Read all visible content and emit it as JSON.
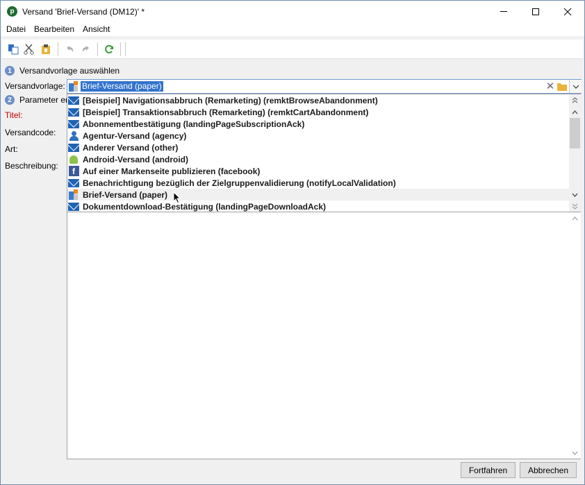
{
  "window": {
    "title": "Versand 'Brief-Versand (DM12)' *",
    "app_icon_glyph": "p"
  },
  "menu": {
    "items": [
      "Datei",
      "Bearbeiten",
      "Ansicht"
    ]
  },
  "toolbar": {
    "icons": [
      "paste-icon",
      "cut-icon",
      "clipboard-icon",
      "undo-icon",
      "redo-icon",
      "refresh-icon"
    ]
  },
  "form": {
    "step1": {
      "number": "1",
      "label": "Versandvorlage auswählen"
    },
    "step2": {
      "number": "2",
      "label": "Parameter er"
    },
    "template_label": "Versandvorlage:",
    "title_label": "Titel:",
    "code_label": "Versandcode:",
    "type_label": "Art:",
    "description_label": "Beschreibung:",
    "template_value": "Brief-Versand (paper)",
    "clear_glyph": "✕"
  },
  "dropdown": {
    "items": [
      {
        "label": "[Beispiel] Navigationsabbruch (Remarketing) (remktBrowseAbandonment)",
        "icon": "mail-icon"
      },
      {
        "label": "[Beispiel] Transaktionsabbruch (Remarketing) (remktCartAbandonment)",
        "icon": "mail-icon"
      },
      {
        "label": "Abonnementbestätigung (landingPageSubscriptionAck)",
        "icon": "mail-icon"
      },
      {
        "label": "Agentur-Versand (agency)",
        "icon": "person-icon"
      },
      {
        "label": "Anderer Versand (other)",
        "icon": "mail-icon"
      },
      {
        "label": "Android-Versand (android)",
        "icon": "android-icon"
      },
      {
        "label": "Auf einer Markenseite publizieren (facebook)",
        "icon": "facebook-icon"
      },
      {
        "label": "Benachrichtigung bezüglich der Zielgruppenvalidierung (notifyLocalValidation)",
        "icon": "mail-icon"
      },
      {
        "label": "Brief-Versand (paper)",
        "icon": "paper-icon"
      },
      {
        "label": "Dokumentdownload-Bestätigung (landingPageDownloadAck)",
        "icon": "mail-icon"
      }
    ],
    "hovered_index": 8,
    "facebook_glyph": "f"
  },
  "buttons": {
    "continue": "Fortfahren",
    "cancel": "Abbrechen"
  },
  "colors": {
    "accent": "#3373cc",
    "step_circle": "#6c8fc7",
    "required_label": "#c00000"
  }
}
